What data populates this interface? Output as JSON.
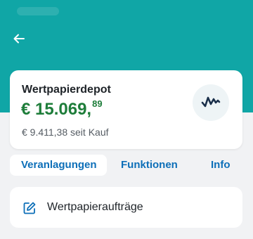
{
  "header": {
    "back_icon": "arrow-left-icon",
    "color": "#10a6a6"
  },
  "account": {
    "title": "Wertpapierdepot",
    "value_main": "€ 15.069,",
    "value_cents": "89",
    "since_purchase": "€ 9.411,38 seit Kauf",
    "value_color": "#1e7d3a",
    "badge_icon": "chart-line-icon"
  },
  "tabs": [
    {
      "label": "Veranlagungen",
      "active": true
    },
    {
      "label": "Funktionen",
      "active": false
    },
    {
      "label": "Info",
      "active": false
    }
  ],
  "actions": [
    {
      "label": "Wertpapieraufträge",
      "icon": "edit-icon"
    }
  ],
  "colors": {
    "link": "#0d6fb8",
    "background": "#f1f2f4"
  }
}
